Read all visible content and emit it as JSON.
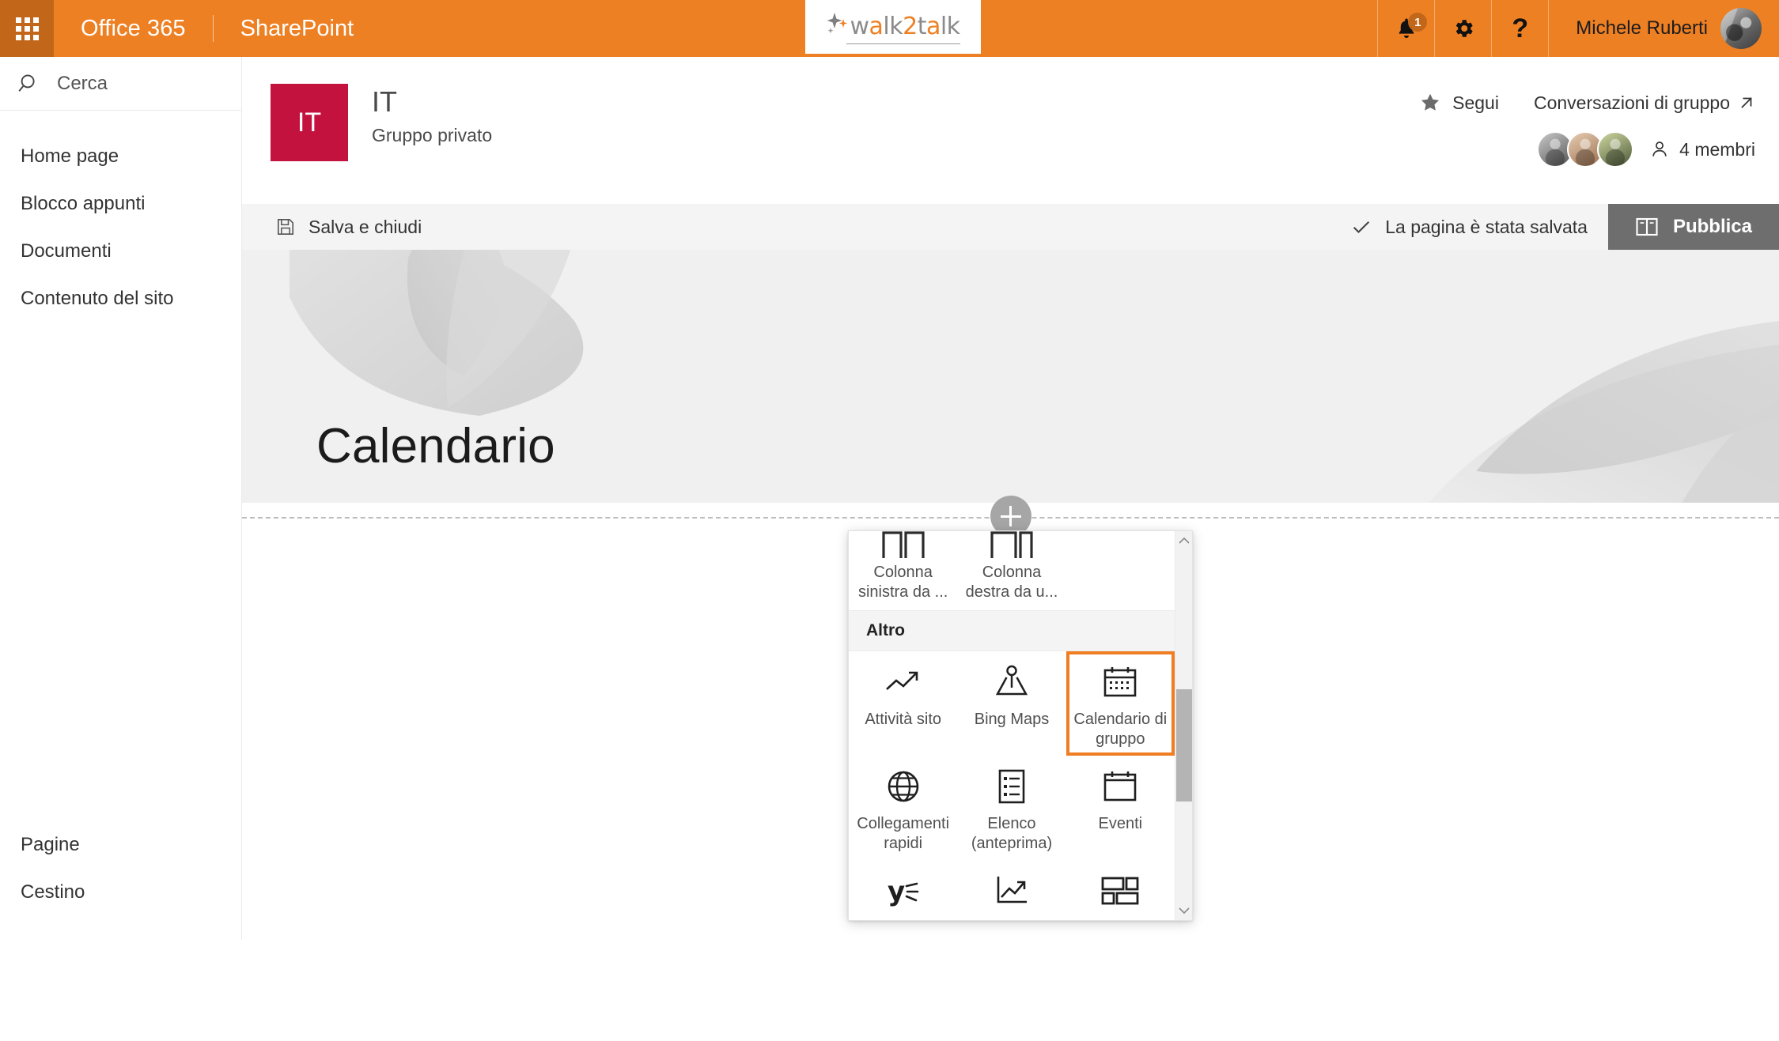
{
  "suite": {
    "waffle_label": "App launcher",
    "brand": "Office 365",
    "app": "SharePoint",
    "notifications_count": "1",
    "user_name": "Michele Ruberti",
    "logo": {
      "part1": "w",
      "part2": "a",
      "part3": "lk",
      "part4": "2",
      "part5": "t",
      "part6": "a",
      "part7": "lk",
      "alt": "walk2talk"
    },
    "colors": {
      "bar": "#ee8024",
      "waffle": "#c2661a",
      "badge": "#c2661a",
      "logo_gray": "#8a8a8a",
      "logo_orange": "#ee8024"
    }
  },
  "sidebar": {
    "search": {
      "placeholder": "Cerca",
      "value": ""
    },
    "items": [
      {
        "label": "Home page"
      },
      {
        "label": "Blocco appunti"
      },
      {
        "label": "Documenti"
      },
      {
        "label": "Contenuto del sito"
      }
    ],
    "bottom_items": [
      {
        "label": "Pagine"
      },
      {
        "label": "Cestino"
      }
    ]
  },
  "site_header": {
    "logo_initials": "IT",
    "logo_color": "#c4123f",
    "title": "IT",
    "subtitle": "Gruppo privato",
    "follow_label": "Segui",
    "conversations_label": "Conversazioni di gruppo",
    "members_label": "4 membri"
  },
  "command_bar": {
    "save_close_label": "Salva e chiudi",
    "saved_status": "La pagina è stata salvata",
    "publish_label": "Pubblica",
    "publish_bg": "#6e6e6e"
  },
  "canvas": {
    "page_title": "Calendario",
    "add_section_label": "+"
  },
  "picker": {
    "top_row": [
      {
        "label": "Colonna sinistra da ...",
        "icon": "left-column-layout-icon"
      },
      {
        "label": "Colonna destra da u...",
        "icon": "right-column-layout-icon"
      }
    ],
    "section_title": "Altro",
    "items": [
      {
        "label": "Attività sito",
        "icon": "trending-up-icon",
        "selected": false
      },
      {
        "label": "Bing Maps",
        "icon": "map-pin-icon",
        "selected": false
      },
      {
        "label": "Calendario di gruppo",
        "icon": "calendar-icon",
        "selected": true
      },
      {
        "label": "Collegamenti rapidi",
        "icon": "globe-icon",
        "selected": false
      },
      {
        "label": "Elenco (anteprima)",
        "icon": "list-document-icon",
        "selected": false
      },
      {
        "label": "Eventi",
        "icon": "calendar-outline-icon",
        "selected": false
      }
    ],
    "partial_items": [
      {
        "label": "",
        "icon": "yammer-icon"
      },
      {
        "label": "",
        "icon": "chart-line-icon"
      },
      {
        "label": "",
        "icon": "tiles-layout-icon"
      }
    ],
    "selection_color": "#ef7d22"
  }
}
